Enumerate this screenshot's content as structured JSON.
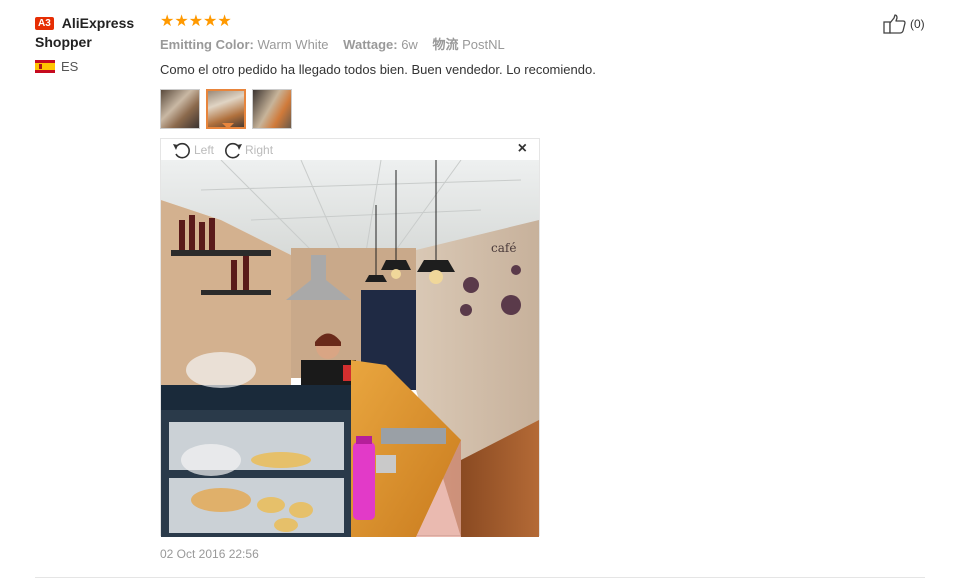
{
  "user": {
    "level_badge": "A3",
    "name_line1": "AliExpress",
    "name_line2": "Shopper",
    "country_code": "ES"
  },
  "review": {
    "stars": "★★★★★",
    "rating": 5,
    "attributes": [
      {
        "key": "Emitting Color:",
        "value": "Warm White"
      },
      {
        "key": "Wattage:",
        "value": "6w"
      },
      {
        "key": "物流",
        "value": "PostNL"
      }
    ],
    "content": "Como el otro pedido ha llegado todos bien. Buen vendedor. Lo recomiendo.",
    "date": "02 Oct 2016 22:56"
  },
  "viewer": {
    "rotate_left_label": "Left",
    "rotate_right_label": "Right",
    "close_symbol": "×"
  },
  "helpful": {
    "count": "(0)"
  },
  "colors": {
    "star": "#ff9900",
    "badge": "#e62e04",
    "active_thumb": "#e8853c"
  }
}
